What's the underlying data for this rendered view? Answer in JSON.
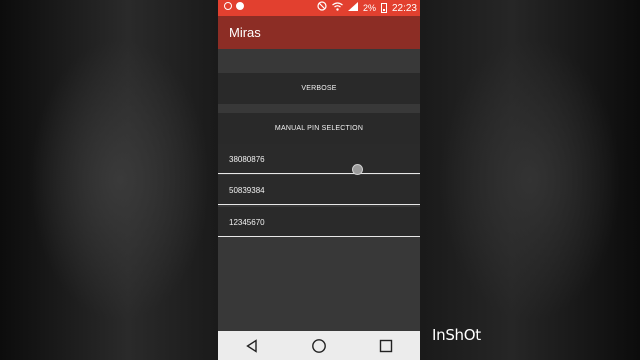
{
  "status_bar": {
    "battery_percent": "2%",
    "time": "22:23"
  },
  "app_bar": {
    "title": "Miras"
  },
  "buttons": {
    "verbose": "VERBOSE",
    "manual_pin": "MANUAL PIN SELECTION"
  },
  "pins": [
    "38080876",
    "50839384",
    "12345670"
  ],
  "watermark": "InShOt",
  "colors": {
    "status_bar": "#e2402f",
    "app_bar": "#8c2d25",
    "content_bg": "#383838",
    "button_bg": "#292929",
    "nav_bar": "#ececec"
  },
  "icons": {
    "status_left": [
      "circle-icon",
      "recording-icon"
    ],
    "status_right": [
      "mute-icon",
      "wifi-icon",
      "signal-icon",
      "battery-icon"
    ],
    "nav": [
      "back-icon",
      "home-icon",
      "recents-icon"
    ]
  }
}
